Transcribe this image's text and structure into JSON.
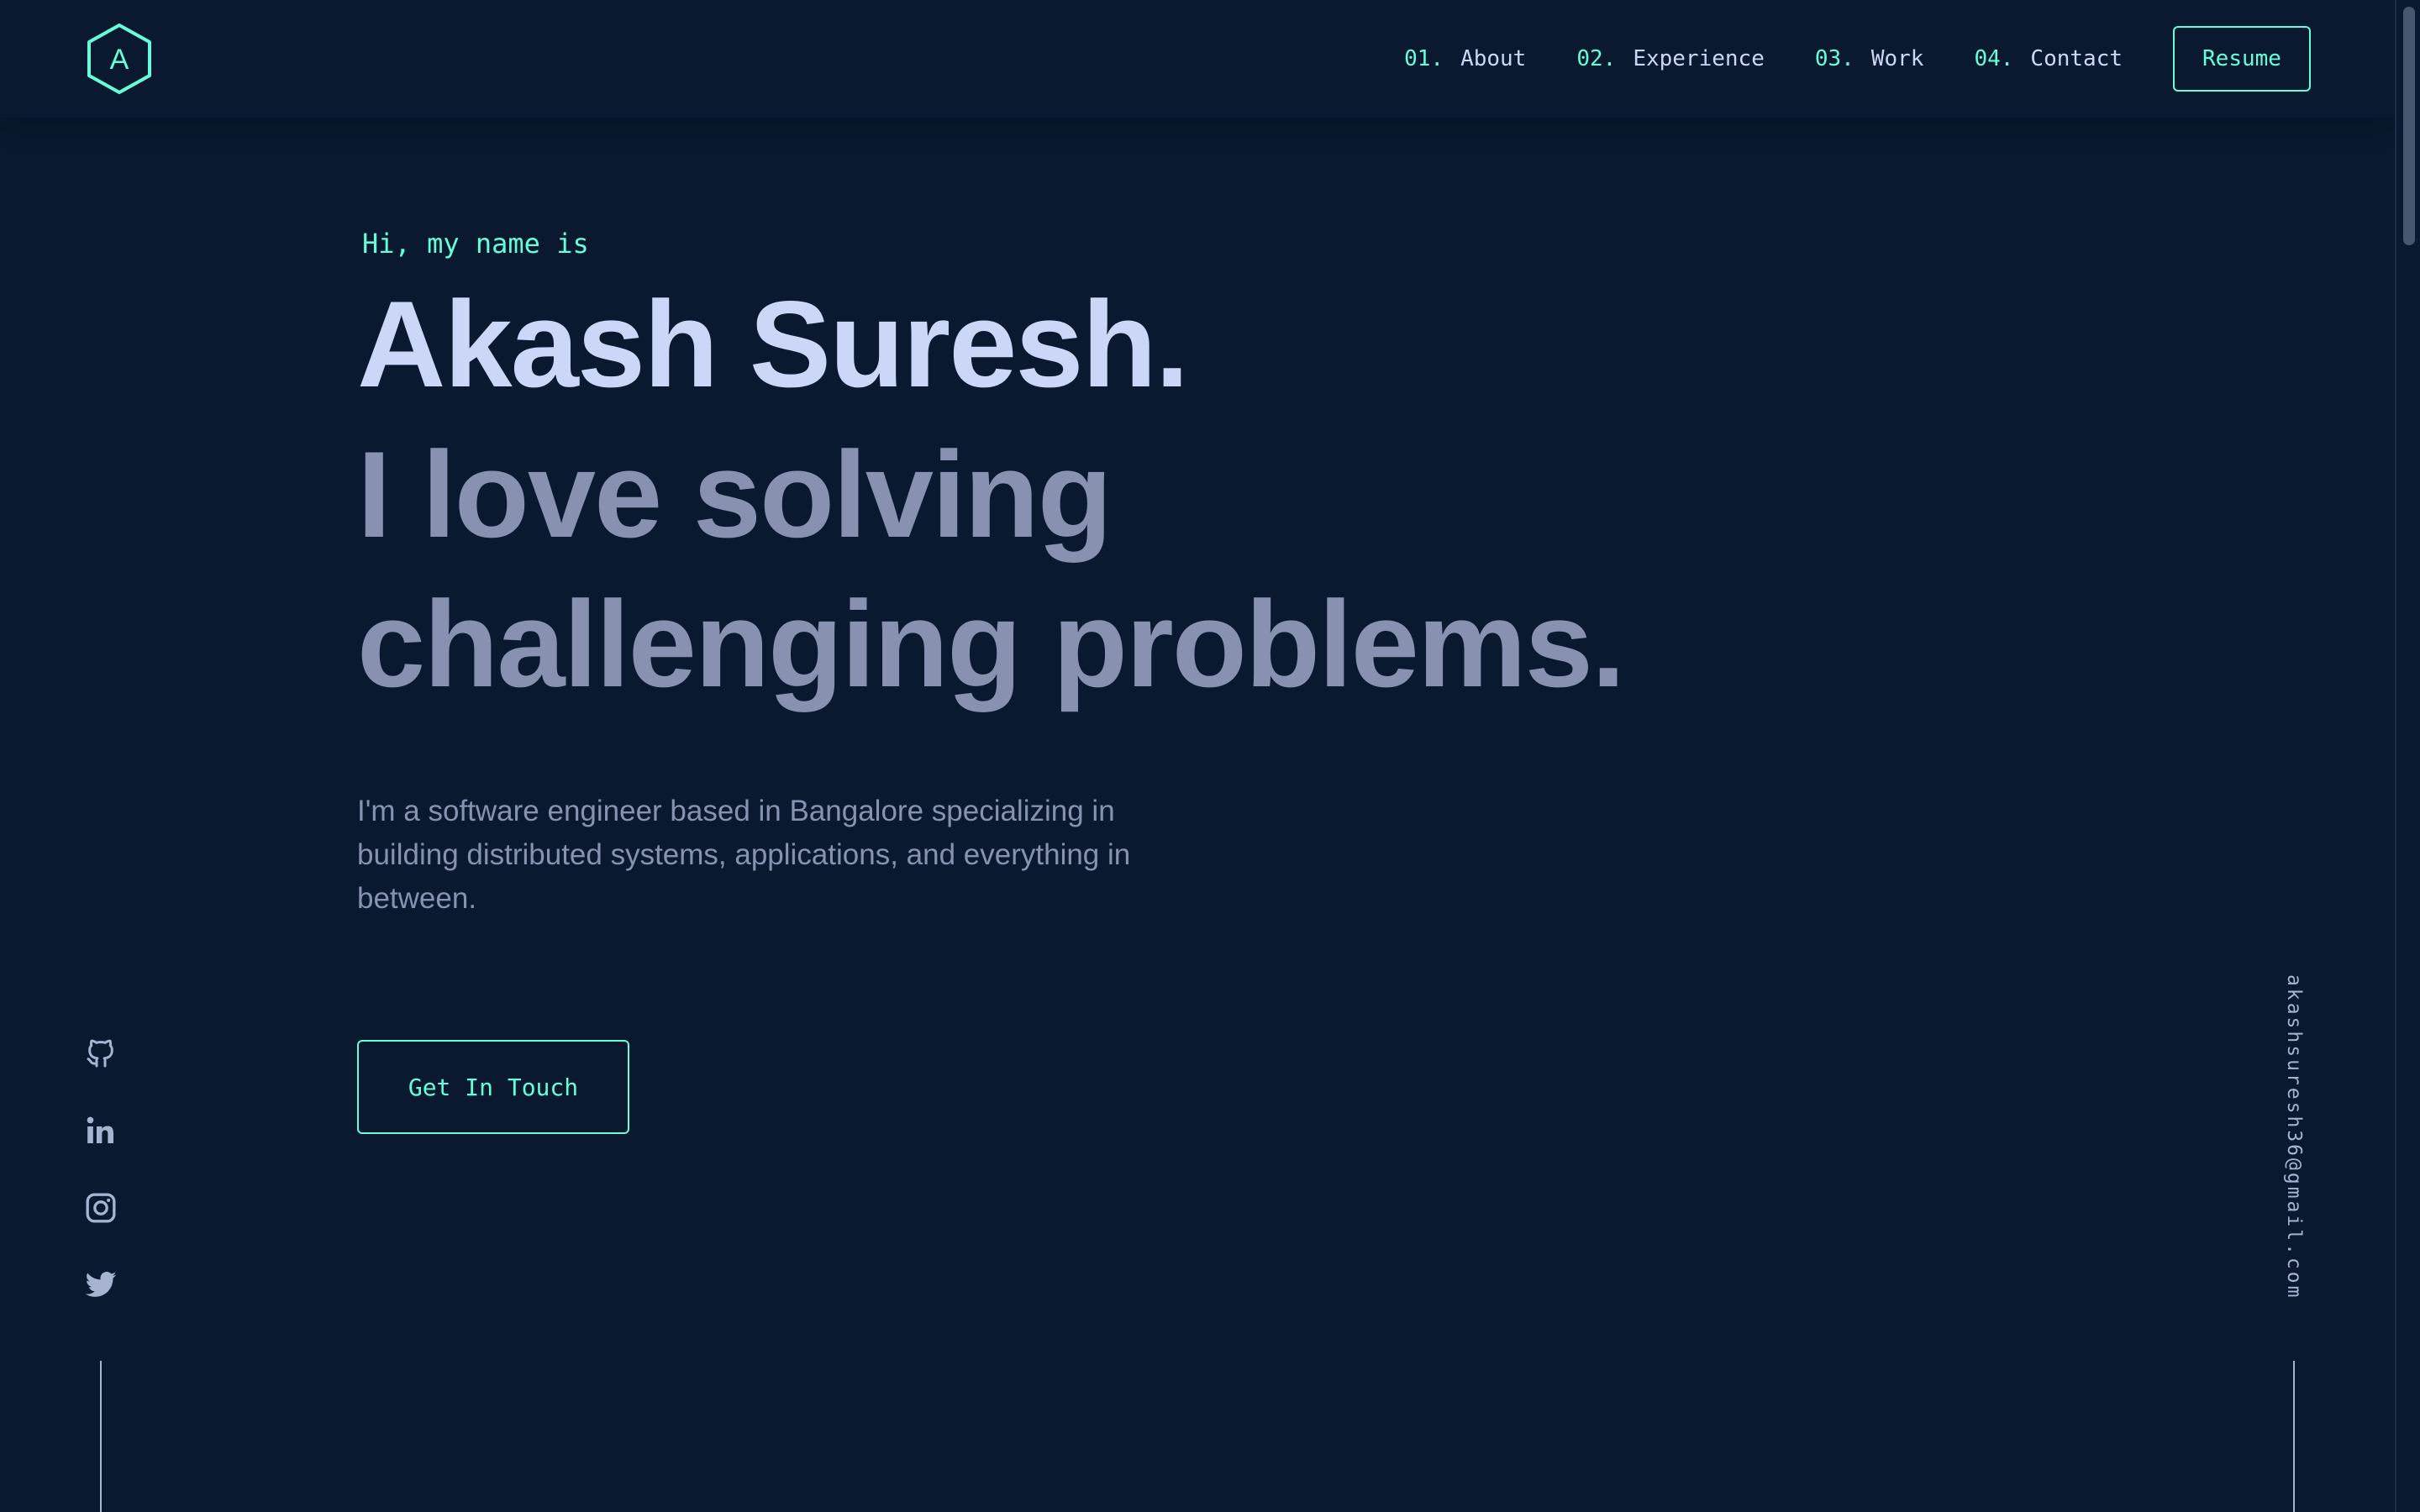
{
  "header": {
    "logo_letter": "A",
    "nav": [
      {
        "num": "01.",
        "label": "About"
      },
      {
        "num": "02.",
        "label": "Experience"
      },
      {
        "num": "03.",
        "label": "Work"
      },
      {
        "num": "04.",
        "label": "Contact"
      }
    ],
    "resume_label": "Resume"
  },
  "hero": {
    "greeting": "Hi, my name is",
    "name": "Akash Suresh.",
    "tagline": "I love solving challenging problems.",
    "bio": "I'm a software engineer based in Bangalore specializing in building distributed systems, applications, and everything in between.",
    "cta_label": "Get In Touch"
  },
  "social": {
    "icons": [
      "github-icon",
      "linkedin-icon",
      "instagram-icon",
      "twitter-icon"
    ]
  },
  "email": "akashsuresh36@gmail.com",
  "colors": {
    "background": "#0a192f",
    "accent": "#64ffda",
    "heading": "#ccd6f6",
    "muted": "#8892b0"
  }
}
